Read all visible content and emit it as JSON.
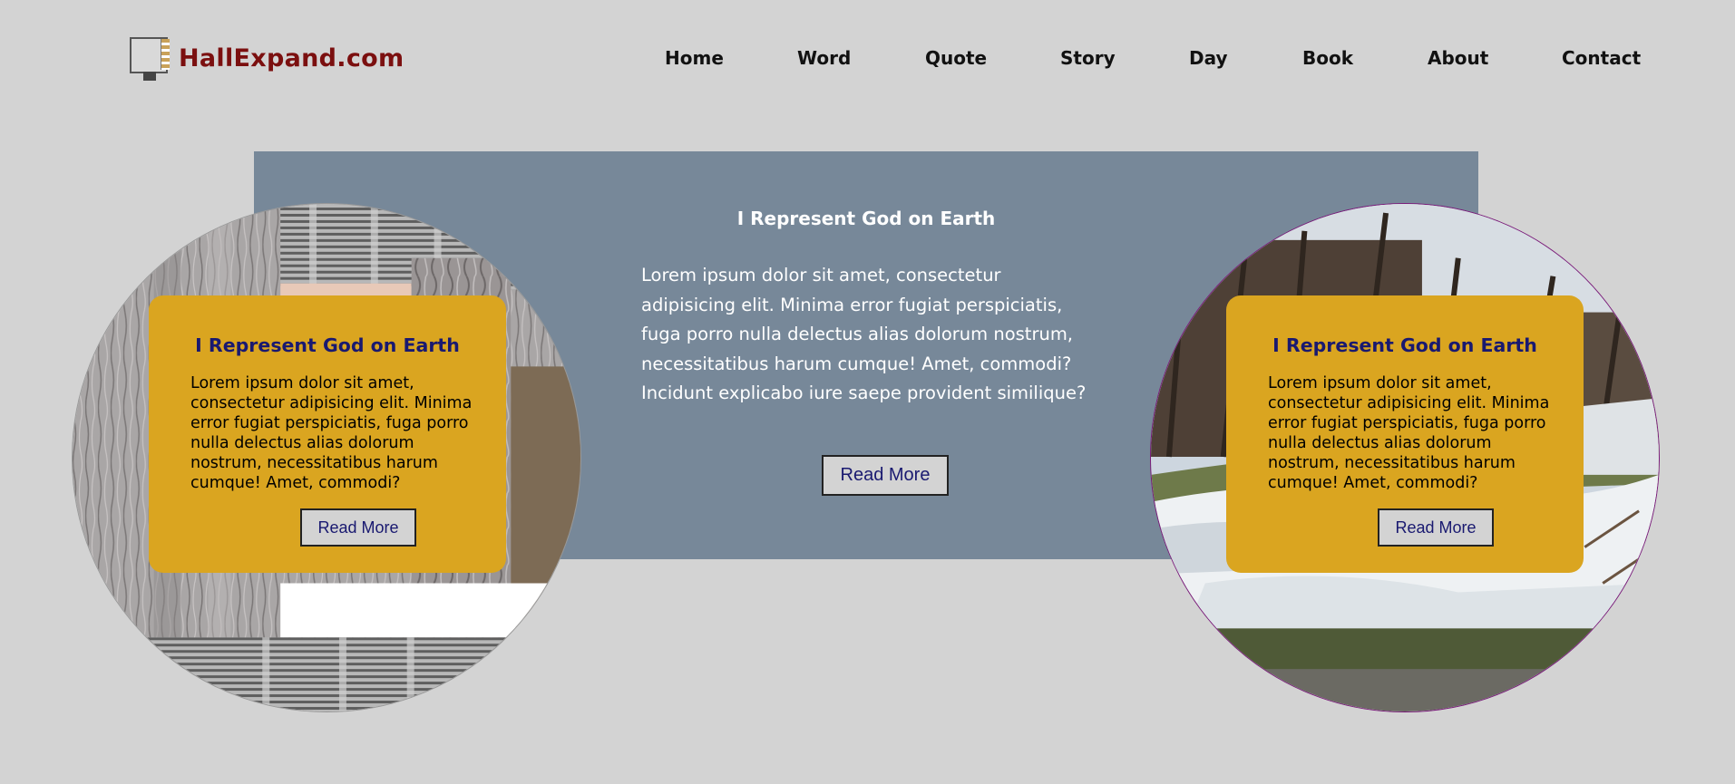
{
  "header": {
    "logo_text": "HallExpand.com",
    "nav": [
      "Home",
      "Word",
      "Quote",
      "Story",
      "Day",
      "Book",
      "About",
      "Contact"
    ]
  },
  "center": {
    "title": "I Represent God on Earth",
    "body": "Lorem ipsum dolor sit amet, consectetur adipisicing elit. Minima error fugiat perspiciatis, fuga porro nulla delectus alias dolorum nostrum, necessitatibus harum cumque! Amet, commodi? Incidunt explicabo iure saepe provident similique?",
    "button": "Read More"
  },
  "cards": [
    {
      "title": "I Represent God on Earth",
      "body": "Lorem ipsum dolor sit amet, consectetur adipisicing elit. Minima error fugiat perspiciatis, fuga porro nulla delectus alias dolorum nostrum, necessitatibus harum cumque! Amet, commodi?",
      "button": "Read More"
    },
    {
      "title": "I Represent God on Earth",
      "body": "Lorem ipsum dolor sit amet, consectetur adipisicing elit. Minima error fugiat perspiciatis, fuga porro nulla delectus alias dolorum nostrum, necessitatibus harum cumque! Amet, commodi?",
      "button": "Read More"
    }
  ],
  "colors": {
    "background": "#d3d3d3",
    "logo": "#7b0f0f",
    "panel": "#778899",
    "card": "#daa520",
    "card_title": "#191970",
    "button_text": "#191970"
  }
}
